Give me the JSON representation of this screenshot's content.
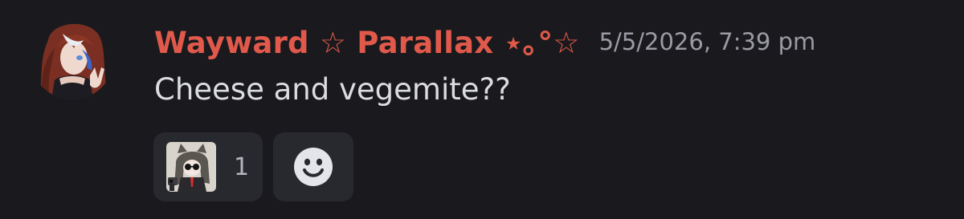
{
  "message": {
    "author": {
      "name": "Wayward ☆ Parallax ⋆｡°☆",
      "name_color": "#e0594a"
    },
    "timestamp": "5/5/2026, 7:39 pm",
    "content": "Cheese and vegemite??",
    "reactions": [
      {
        "emoji": "custom-anime-emoji-with-pistol",
        "count": "1"
      }
    ],
    "add_reaction_icon": "smile-icon"
  }
}
